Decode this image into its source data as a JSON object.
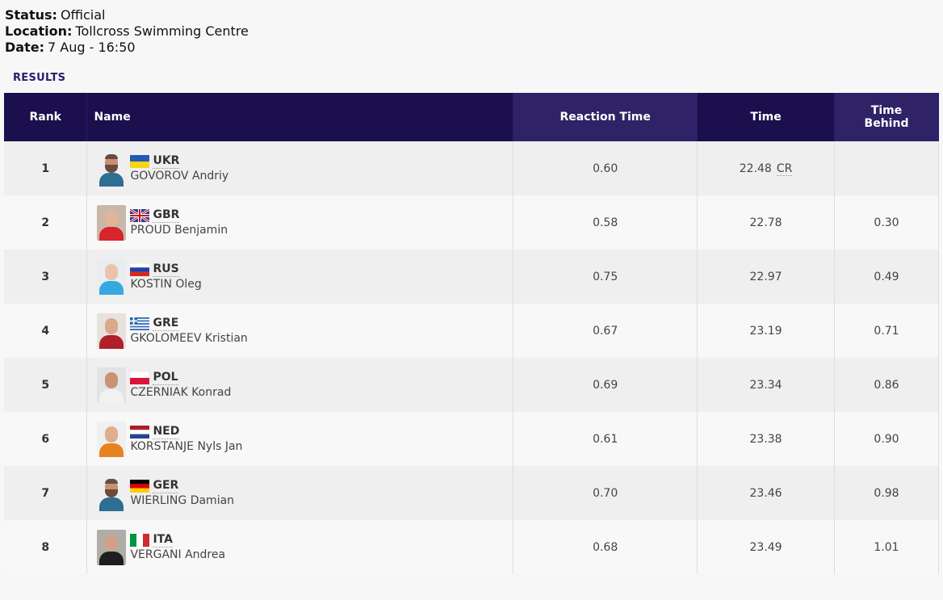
{
  "info": {
    "status_label": "Status:",
    "status_value": "Official",
    "location_label": "Location:",
    "location_value": "Tollcross Swimming Centre",
    "date_label": "Date:",
    "date_value": "7 Aug - 16:50"
  },
  "results_label": "RESULTS",
  "columns": {
    "rank": "Rank",
    "name": "Name",
    "reaction": "Reaction Time",
    "time": "Time",
    "behind_line1": "Time",
    "behind_line2": "Behind"
  },
  "colors": {
    "header_bg": "#1b0f4d",
    "header_highlight_bg": "#2f2266",
    "results_label": "#2b1d6e"
  },
  "rows": [
    {
      "rank": "1",
      "noc": "UKR",
      "name": "GOVOROV Andriy",
      "reaction": "0.60",
      "time": "22.48",
      "record": "CR",
      "behind": "",
      "photo": "avatar-icon"
    },
    {
      "rank": "2",
      "noc": "GBR",
      "name": "PROUD Benjamin",
      "reaction": "0.58",
      "time": "22.78",
      "record": "",
      "behind": "0.30",
      "photo": "athlete-photo"
    },
    {
      "rank": "3",
      "noc": "RUS",
      "name": "KOSTIN Oleg",
      "reaction": "0.75",
      "time": "22.97",
      "record": "",
      "behind": "0.49",
      "photo": "athlete-photo"
    },
    {
      "rank": "4",
      "noc": "GRE",
      "name": "GKOLOMEEV Kristian",
      "reaction": "0.67",
      "time": "23.19",
      "record": "",
      "behind": "0.71",
      "photo": "athlete-photo"
    },
    {
      "rank": "5",
      "noc": "POL",
      "name": "CZERNIAK Konrad",
      "reaction": "0.69",
      "time": "23.34",
      "record": "",
      "behind": "0.86",
      "photo": "athlete-photo"
    },
    {
      "rank": "6",
      "noc": "NED",
      "name": "KORSTANJE Nyls Jan",
      "reaction": "0.61",
      "time": "23.38",
      "record": "",
      "behind": "0.90",
      "photo": "athlete-photo"
    },
    {
      "rank": "7",
      "noc": "GER",
      "name": "WIERLING Damian",
      "reaction": "0.70",
      "time": "23.46",
      "record": "",
      "behind": "0.98",
      "photo": "avatar-icon"
    },
    {
      "rank": "8",
      "noc": "ITA",
      "name": "VERGANI Andrea",
      "reaction": "0.68",
      "time": "23.49",
      "record": "",
      "behind": "1.01",
      "photo": "athlete-photo"
    }
  ]
}
